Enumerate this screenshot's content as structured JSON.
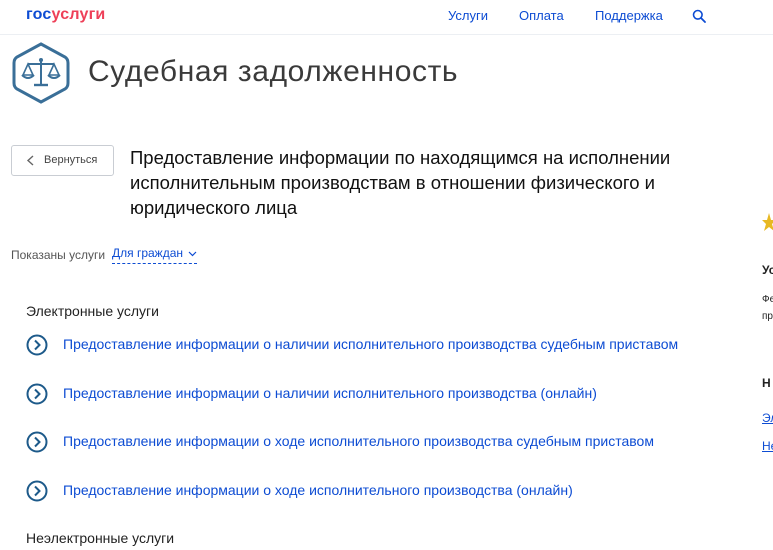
{
  "header": {
    "logo_part1": "гос",
    "logo_part2": "услуги",
    "nav": [
      "Услуги",
      "Оплата",
      "Поддержка"
    ]
  },
  "department": {
    "title": "Судебная задолженность"
  },
  "back_button": {
    "label": "Вернуться"
  },
  "page": {
    "title": "Предоставление информации по находящимся на исполнении исполнительным производствам в отношении физического и юридического лица"
  },
  "filter": {
    "label": "Показаны услуги",
    "value": "Для граждан"
  },
  "electronic": {
    "title": "Электронные услуги",
    "items": [
      "Предоставление информации о наличии исполнительного производства судебным приставом",
      "Предоставление информации о наличии исполнительного производства (онлайн)",
      "Предоставление информации о ходе исполнительного производства судебным приставом",
      "Предоставление информации о ходе исполнительного производства (онлайн)"
    ]
  },
  "non_electronic": {
    "title": "Неэлектронные услуги"
  },
  "sidebar": {
    "heading1": "Ус",
    "text1": "Фе",
    "text2": "пр",
    "heading2": "Н",
    "link1": "Эл",
    "link2": "Не"
  },
  "colors": {
    "brand_blue": "#0d4cd3",
    "brand_red": "#ee3f58",
    "emblem": "#3a6f98",
    "service_icon": "#1d5a8a"
  }
}
